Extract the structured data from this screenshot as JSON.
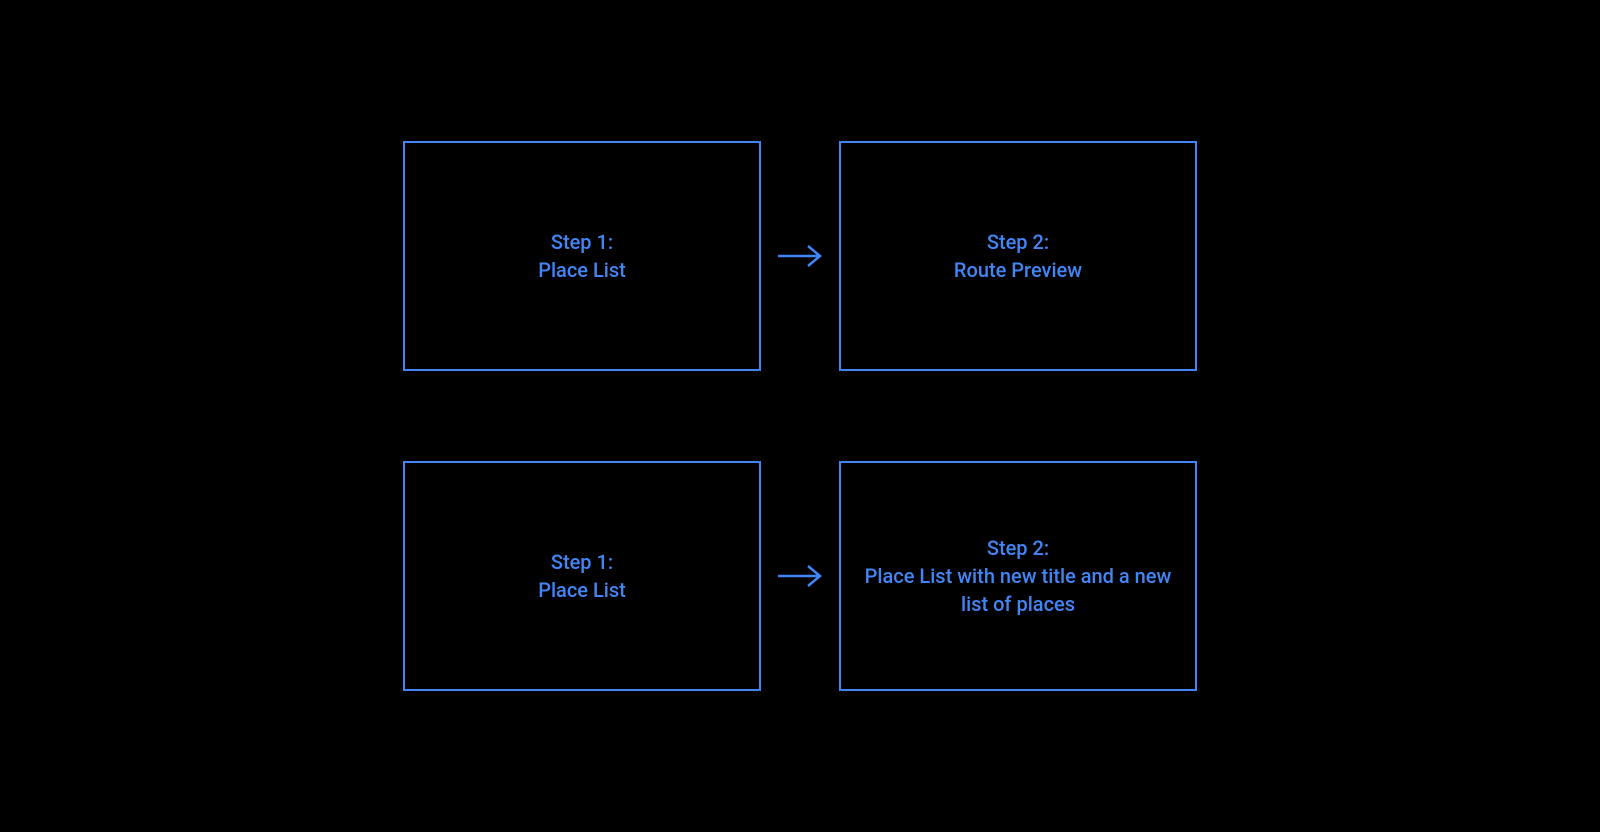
{
  "colors": {
    "accent": "#4285f4",
    "background": "#000000"
  },
  "flows": [
    {
      "step1": {
        "title": "Step 1:",
        "subtitle": "Place List"
      },
      "step2": {
        "title": "Step 2:",
        "subtitle": "Route Preview"
      }
    },
    {
      "step1": {
        "title": "Step 1:",
        "subtitle": "Place List"
      },
      "step2": {
        "title": "Step 2:",
        "subtitle": "Place List with new title and a new list of places"
      }
    }
  ]
}
